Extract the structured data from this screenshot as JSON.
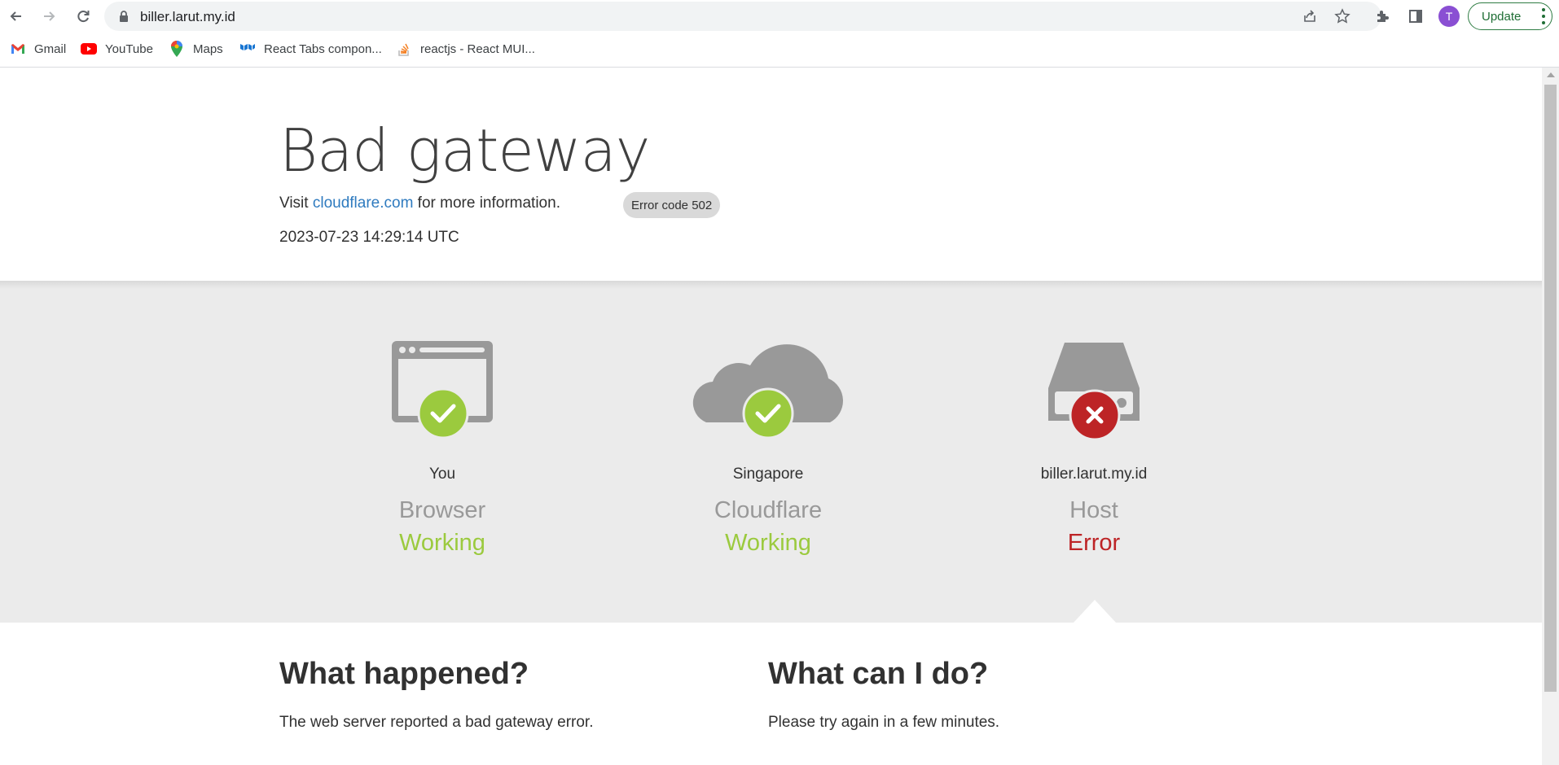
{
  "browser": {
    "url": "biller.larut.my.id",
    "avatar_initial": "T",
    "update_label": "Update",
    "bookmarks": [
      {
        "label": "Gmail",
        "icon": "gmail-icon"
      },
      {
        "label": "YouTube",
        "icon": "youtube-icon"
      },
      {
        "label": "Maps",
        "icon": "maps-icon"
      },
      {
        "label": "React Tabs compon...",
        "icon": "mui-icon"
      },
      {
        "label": "reactjs - React MUI...",
        "icon": "stackoverflow-icon"
      }
    ]
  },
  "page": {
    "title": "Bad gateway",
    "error_badge": "Error code 502",
    "visit_prefix": "Visit ",
    "visit_link": "cloudflare.com",
    "visit_suffix": " for more information.",
    "timestamp": "2023-07-23 14:29:14 UTC",
    "nodes": [
      {
        "location": "You",
        "name": "Browser",
        "status": "Working",
        "icon": "browser-icon",
        "state": "ok"
      },
      {
        "location": "Singapore",
        "name": "Cloudflare",
        "status": "Working",
        "icon": "cloud-icon",
        "state": "ok"
      },
      {
        "location": "biller.larut.my.id",
        "name": "Host",
        "status": "Error",
        "icon": "server-icon",
        "state": "error"
      }
    ],
    "what_happened": {
      "heading": "What happened?",
      "text": "The web server reported a bad gateway error."
    },
    "what_can_i_do": {
      "heading": "What can I do?",
      "text": "Please try again in a few minutes."
    }
  },
  "colors": {
    "working": "#9bca3e",
    "error": "#bd2426",
    "link": "#2f7bbf",
    "icon_gray": "#999999"
  }
}
